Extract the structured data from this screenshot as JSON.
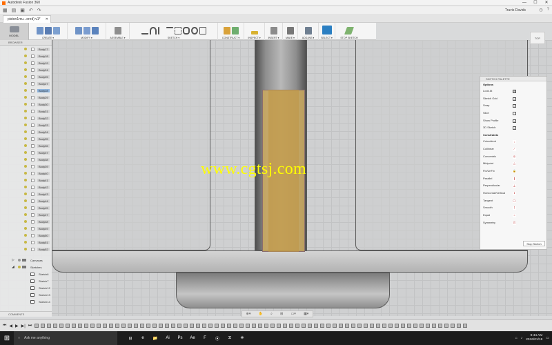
{
  "window": {
    "title": "Autodesk Fusion 360",
    "controls": [
      "—",
      "☐",
      "✕"
    ]
  },
  "quick_access": {
    "user": "Travis Davids",
    "icons": [
      "grid-icon",
      "file-icon",
      "save-icon",
      "undo-icon",
      "redo-icon"
    ]
  },
  "doc_tab": {
    "label": "piston1mu...ered) v1*",
    "close": "✕"
  },
  "toolbar": {
    "workspace": "MODEL",
    "groups": [
      {
        "label": "CREATE ▾"
      },
      {
        "label": "MODIFY ▾"
      },
      {
        "label": "ASSEMBLE ▾"
      },
      {
        "label": "SKETCH ▾"
      },
      {
        "label": "CONSTRUCT ▾"
      },
      {
        "label": "INSPECT ▾"
      },
      {
        "label": "INSERT ▾"
      },
      {
        "label": "MAKE ▾"
      },
      {
        "label": "ADD-INS ▾"
      },
      {
        "label": "SELECT ▾"
      },
      {
        "label": "STOP SKETCH"
      }
    ]
  },
  "viewcube": {
    "label": "TOP"
  },
  "browser": {
    "header": "BROWSER",
    "bodies": [
      "Body17",
      "Body18",
      "Body19",
      "Body24",
      "Body25",
      "Body27",
      "Body28",
      "Body29",
      "Body30",
      "Body31",
      "Body32",
      "Body33",
      "Body34",
      "Body35",
      "Body36",
      "Body37",
      "Body38",
      "Body39",
      "Body40",
      "Body41",
      "Body42",
      "Body43",
      "Body44",
      "Body45",
      "Body47",
      "Body48",
      "Body49",
      "Body50",
      "Body51",
      "Body52"
    ],
    "selected": "Body28",
    "folders": [
      "Canvases",
      "Sketches"
    ],
    "sketches": [
      "Sketch6",
      "Sketch7",
      "Sketch12",
      "Sketch13",
      "Sketch14"
    ],
    "comments": "COMMENTS"
  },
  "sketch_palette": {
    "header": "SKETCH PALETTE",
    "options_title": "Options",
    "options": [
      {
        "label": "Look At",
        "control": "⊡"
      },
      {
        "label": "Sketch Grid",
        "control": "✓"
      },
      {
        "label": "Snap",
        "control": "✓"
      },
      {
        "label": "Slice",
        "control": ""
      },
      {
        "label": "Show Profile",
        "control": "✓"
      },
      {
        "label": "3D Sketch",
        "control": "✓"
      }
    ],
    "constraints_title": "Constraints",
    "constraints": [
      "Coincident",
      "Collinear",
      "Concentric",
      "Midpoint",
      "Fix/UnFix",
      "Parallel",
      "Perpendicular",
      "Horizontal/Vertical",
      "Tangent",
      "Smooth",
      "Equal",
      "Symmetry"
    ],
    "stop_button": "Stop Sketch"
  },
  "watermark": "www.cgtsj.com",
  "navbar": {
    "icons": [
      "⊕▾",
      "✋",
      "⌕",
      "⊞",
      "▭▾",
      "▦▾"
    ]
  },
  "timeline": {
    "controls": [
      "⏮",
      "◀",
      "▶",
      "▶|",
      "⏭"
    ]
  },
  "taskbar": {
    "search_placeholder": "Ask me anything",
    "time": "9:44 AM",
    "date": "2016/01/18",
    "apps": [
      "⊟",
      "e",
      "📁",
      "Ai",
      "Ps",
      "Ae",
      "F",
      "⦿",
      "⧖",
      "⎈"
    ]
  },
  "colors": {
    "accent": "#2b7fc2",
    "selection": "#8fb5de",
    "watermark": "#ffff00"
  }
}
